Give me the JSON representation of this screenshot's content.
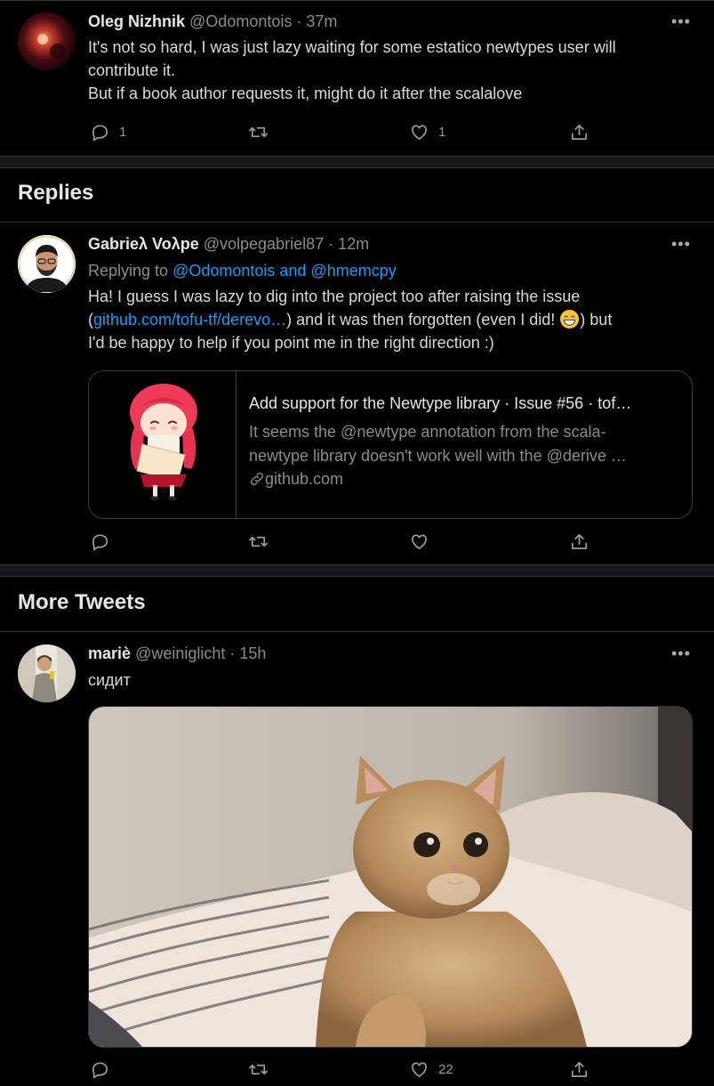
{
  "tweets": [
    {
      "name": "Oleg Nizhnik",
      "handle": "@Odomontois",
      "time": "· 37m",
      "line1": "It's not so hard, I was just lazy waiting for some estatico newtypes user will",
      "line2": "contribute it.",
      "line3": "But if a book author requests it, might do it after the scalalove",
      "reply_count": "1",
      "like_count": "1"
    },
    {
      "name": "Gabrieλ Voλpe",
      "handle": "@volpegabriel87",
      "time": "· 12m",
      "replying_prefix": "Replying to",
      "replying_to": "@Odomontois and @hmemcpy",
      "line1": "Ha! I guess I was lazy to dig into the project too after raising the issue",
      "line2_pre": "(",
      "line2_link": "github.com/tofu-tf/derevo…",
      "line2_post": ") and it was then forgotten (even I did! ",
      "line2_end": ") but",
      "line3": "I'd be happy to help if you point me in the right direction :)",
      "card": {
        "title": "Add support for the Newtype library · Issue #56 · tof…",
        "desc_line1": "It seems the @newtype annotation from the scala-",
        "desc_line2": "newtype library doesn't work well with the @derive …",
        "domain": "github.com"
      }
    },
    {
      "name": "mariè",
      "handle": "@weiniglicht",
      "time": "· 15h",
      "text": "сидит",
      "like_count": "22"
    }
  ],
  "sections": {
    "replies": "Replies",
    "more_tweets": "More Tweets"
  },
  "more_menu": "•••",
  "colors": {
    "link": "#1d9bf0",
    "background": "#000000"
  },
  "icons": [
    "reply-icon",
    "retweet-icon",
    "like-icon",
    "share-icon",
    "more-icon",
    "link-icon"
  ]
}
